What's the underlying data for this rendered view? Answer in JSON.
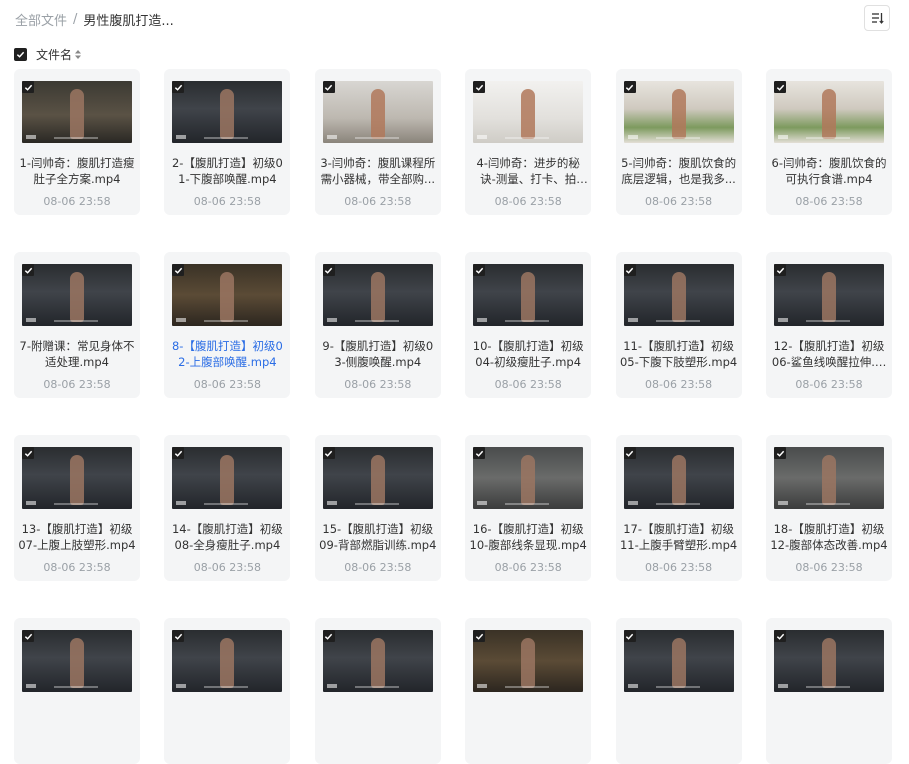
{
  "breadcrumb": {
    "root": "全部文件",
    "separator": "/",
    "current": "男性腹肌打造..."
  },
  "toolbar": {
    "sort_icon": "sort-list-icon"
  },
  "list_header": {
    "label": "文件名",
    "checked": true
  },
  "colors": {
    "accent": "#2b6de5",
    "card_bg": "#f4f5f6",
    "checkbox": "#1f1f1f",
    "muted": "#9aa0a6"
  },
  "files": [
    {
      "name": "1-闫帅奇：腹肌打造瘦肚子全方案.mp4",
      "date": "08-06 23:58",
      "scene": "outdoor"
    },
    {
      "name": "2-【腹肌打造】初级01-下腹部唤醒.mp4",
      "date": "08-06 23:58",
      "scene": "dark"
    },
    {
      "name": "3-闫帅奇：腹肌课程所需小器械，带全部购...",
      "date": "08-06 23:58",
      "scene": "room"
    },
    {
      "name": "4-闫帅奇：进步的秘诀-测量、打卡、拍照...",
      "date": "08-06 23:58",
      "scene": "white"
    },
    {
      "name": "5-闫帅奇：腹肌饮食的底层逻辑，也是我多...",
      "date": "08-06 23:58",
      "scene": "kitchen"
    },
    {
      "name": "6-闫帅奇：腹肌饮食的可执行食谱.mp4",
      "date": "08-06 23:58",
      "scene": "kitchen"
    },
    {
      "name": "7-附赠课：常见身体不适处理.mp4",
      "date": "08-06 23:58",
      "scene": "dark"
    },
    {
      "name": "8-【腹肌打造】初级02-上腹部唤醒.mp4",
      "date": "08-06 23:58",
      "scene": "warm",
      "active": true
    },
    {
      "name": "9-【腹肌打造】初级03-侧腹唤醒.mp4",
      "date": "08-06 23:58",
      "scene": "dark"
    },
    {
      "name": "10-【腹肌打造】初级04-初级瘦肚子.mp4",
      "date": "08-06 23:58",
      "scene": "dark"
    },
    {
      "name": "11-【腹肌打造】初级05-下腹下肢塑形.mp4",
      "date": "08-06 23:58",
      "scene": "dark"
    },
    {
      "name": "12-【腹肌打造】初级06-鲨鱼线唤醒拉伸.mp4",
      "date": "08-06 23:58",
      "scene": "dark"
    },
    {
      "name": "13-【腹肌打造】初级07-上腹上肢塑形.mp4",
      "date": "08-06 23:58",
      "scene": "dark"
    },
    {
      "name": "14-【腹肌打造】初级08-全身瘦肚子.mp4",
      "date": "08-06 23:58",
      "scene": "dark"
    },
    {
      "name": "15-【腹肌打造】初级09-背部燃脂训练.mp4",
      "date": "08-06 23:58",
      "scene": "dark"
    },
    {
      "name": "16-【腹肌打造】初级10-腹部线条显现.mp4",
      "date": "08-06 23:58",
      "scene": "grey"
    },
    {
      "name": "17-【腹肌打造】初级11-上腹手臂塑形.mp4",
      "date": "08-06 23:58",
      "scene": "dark"
    },
    {
      "name": "18-【腹肌打造】初级12-腹部体态改善.mp4",
      "date": "08-06 23:58",
      "scene": "grey"
    },
    {
      "name": "",
      "date": "",
      "scene": "dark"
    },
    {
      "name": "",
      "date": "",
      "scene": "dark"
    },
    {
      "name": "",
      "date": "",
      "scene": "dark"
    },
    {
      "name": "",
      "date": "",
      "scene": "warm"
    },
    {
      "name": "",
      "date": "",
      "scene": "dark"
    },
    {
      "name": "",
      "date": "",
      "scene": "dark"
    }
  ]
}
